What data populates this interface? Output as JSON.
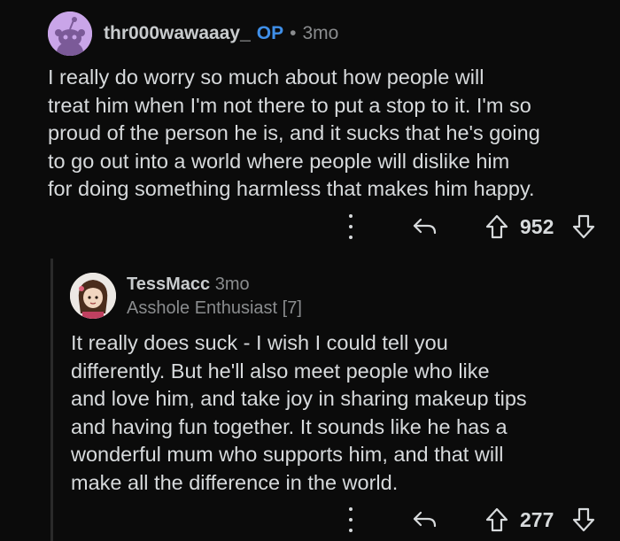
{
  "op_comment": {
    "username": "thr000wawaaay_",
    "op_badge": "OP",
    "separator": "•",
    "time": "3mo",
    "body_lines": [
      "I really do worry so much about how people will",
      "treat him when I'm not there to put a stop to it. I'm so",
      "proud of the person he is, and it sucks that he's going",
      "to go out into a world where people will dislike him",
      "for doing something harmless that makes him happy."
    ],
    "score": "952"
  },
  "reply_comment": {
    "username": "TessMacc",
    "time": "3mo",
    "flair": "Asshole Enthusiast [7]",
    "body_lines": [
      "It really does suck - I wish I could tell you",
      "differently. But he'll also meet people who like",
      "and love him, and take joy in sharing makeup tips",
      "and having fun together. It sounds like he has a",
      "wonderful mum who supports him, and that will",
      "make all the difference in the world."
    ],
    "score": "277"
  },
  "icons": {
    "more": "more-vertical-icon",
    "reply": "reply-arrow-icon",
    "upvote": "upvote-arrow-icon",
    "downvote": "downvote-arrow-icon"
  },
  "colors": {
    "background": "#0b0b0b",
    "op_badge": "#3f8fe8",
    "text": "#d7dadc",
    "muted": "#8a8c8e"
  }
}
